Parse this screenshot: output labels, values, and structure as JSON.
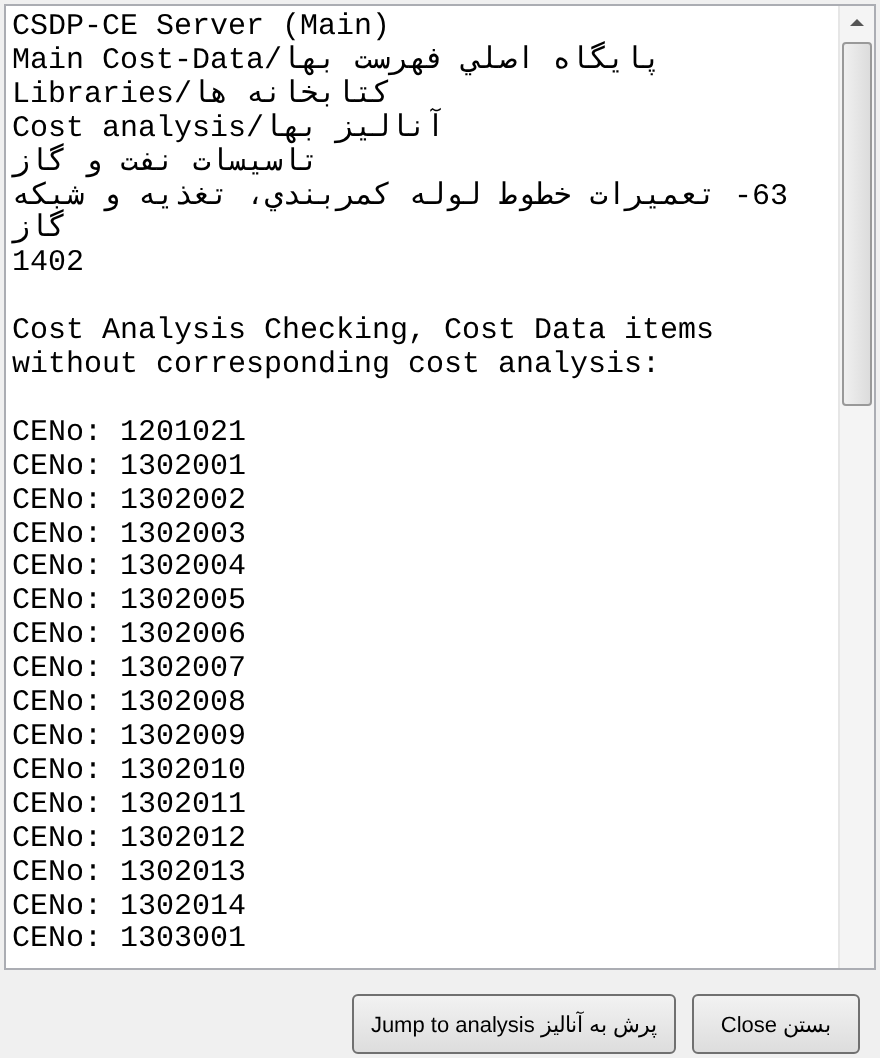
{
  "output": {
    "header_lines": [
      "CSDP-CE Server (Main)",
      "Main Cost-Data/پايگاه اصلي فهرست بها",
      "Libraries/كتابخانه ها",
      "Cost analysis/آناليز بها",
      "تاسيسات نفت و گاز",
      "63- تعميرات خطوط لوله كمربندي، تغذيه و شبكه",
      "گاز",
      "1402"
    ],
    "message_lines": [
      "Cost Analysis Checking, Cost Data items",
      "without corresponding cost analysis:"
    ],
    "entries": [
      "CENo: 1201021",
      "CENo: 1302001",
      "CENo: 1302002",
      "CENo: 1302003",
      "CENo: 1302004",
      "CENo: 1302005",
      "CENo: 1302006",
      "CENo: 1302007",
      "CENo: 1302008",
      "CENo: 1302009",
      "CENo: 1302010",
      "CENo: 1302011",
      "CENo: 1302012",
      "CENo: 1302013",
      "CENo: 1302014",
      "CENo: 1303001"
    ]
  },
  "buttons": [
    {
      "label": "Jump to analysis  پرش به آناليز"
    },
    {
      "label": "Close  بستن"
    }
  ]
}
